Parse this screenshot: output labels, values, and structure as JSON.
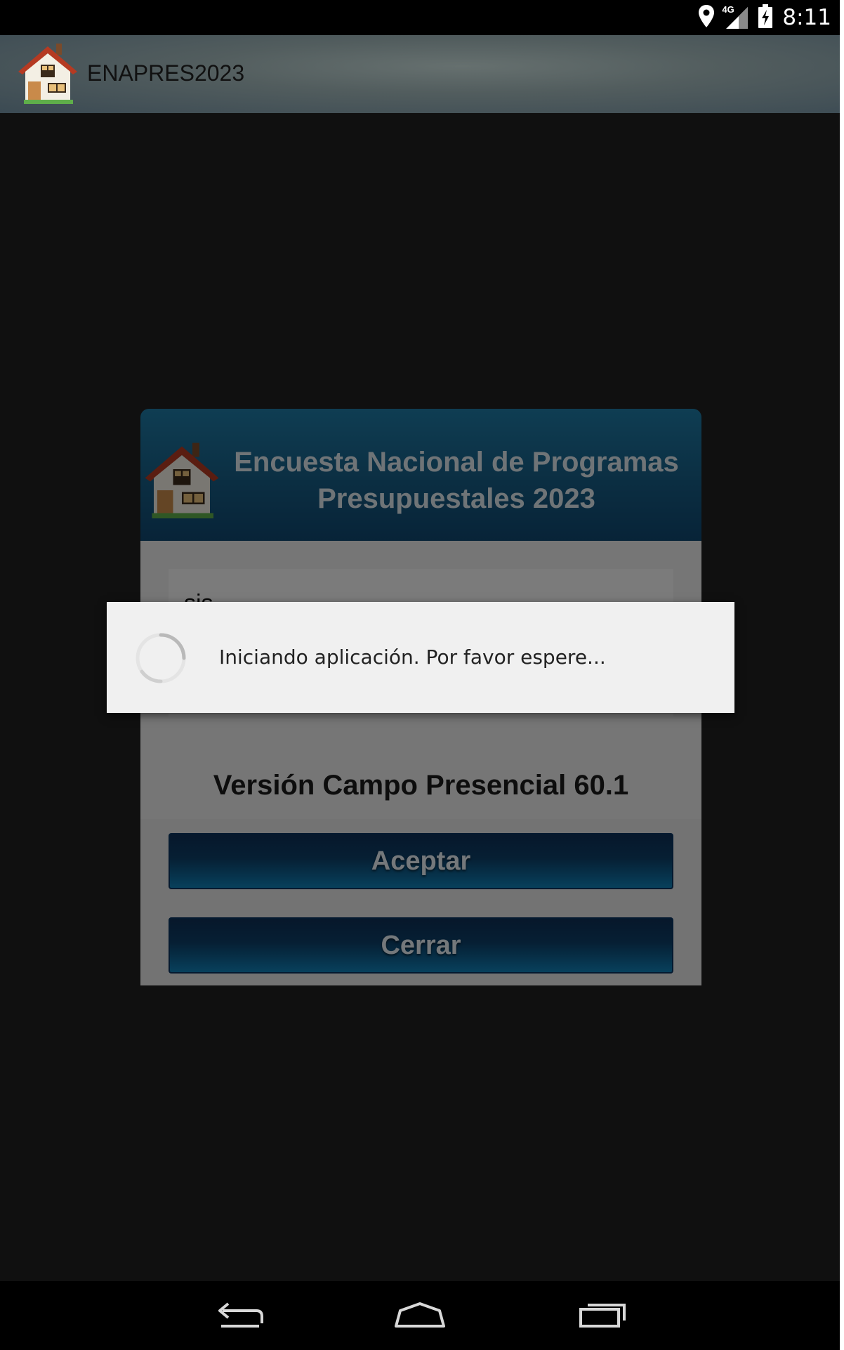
{
  "status_bar": {
    "time": "8:11",
    "icons": [
      "location-icon",
      "signal-4g-icon",
      "battery-charging-icon"
    ],
    "network_label": "4G"
  },
  "action_bar": {
    "title": "ENAPRES2023",
    "icon": "house-icon"
  },
  "login_dialog": {
    "title": "Encuesta Nacional de Programas Presupuestales 2023",
    "user_field_value": "sis",
    "version": "Versión Campo Presencial  60.1",
    "accept_label": "Aceptar",
    "close_label": "Cerrar"
  },
  "progress_dialog": {
    "message": "Iniciando aplicación. Por favor espere..."
  },
  "nav_bar": {
    "items": [
      "back-icon",
      "home-icon",
      "recents-icon"
    ]
  },
  "colors": {
    "header_blue": "#175d85",
    "button_blue": "#0c3f68",
    "screen_bg": "#212121"
  }
}
